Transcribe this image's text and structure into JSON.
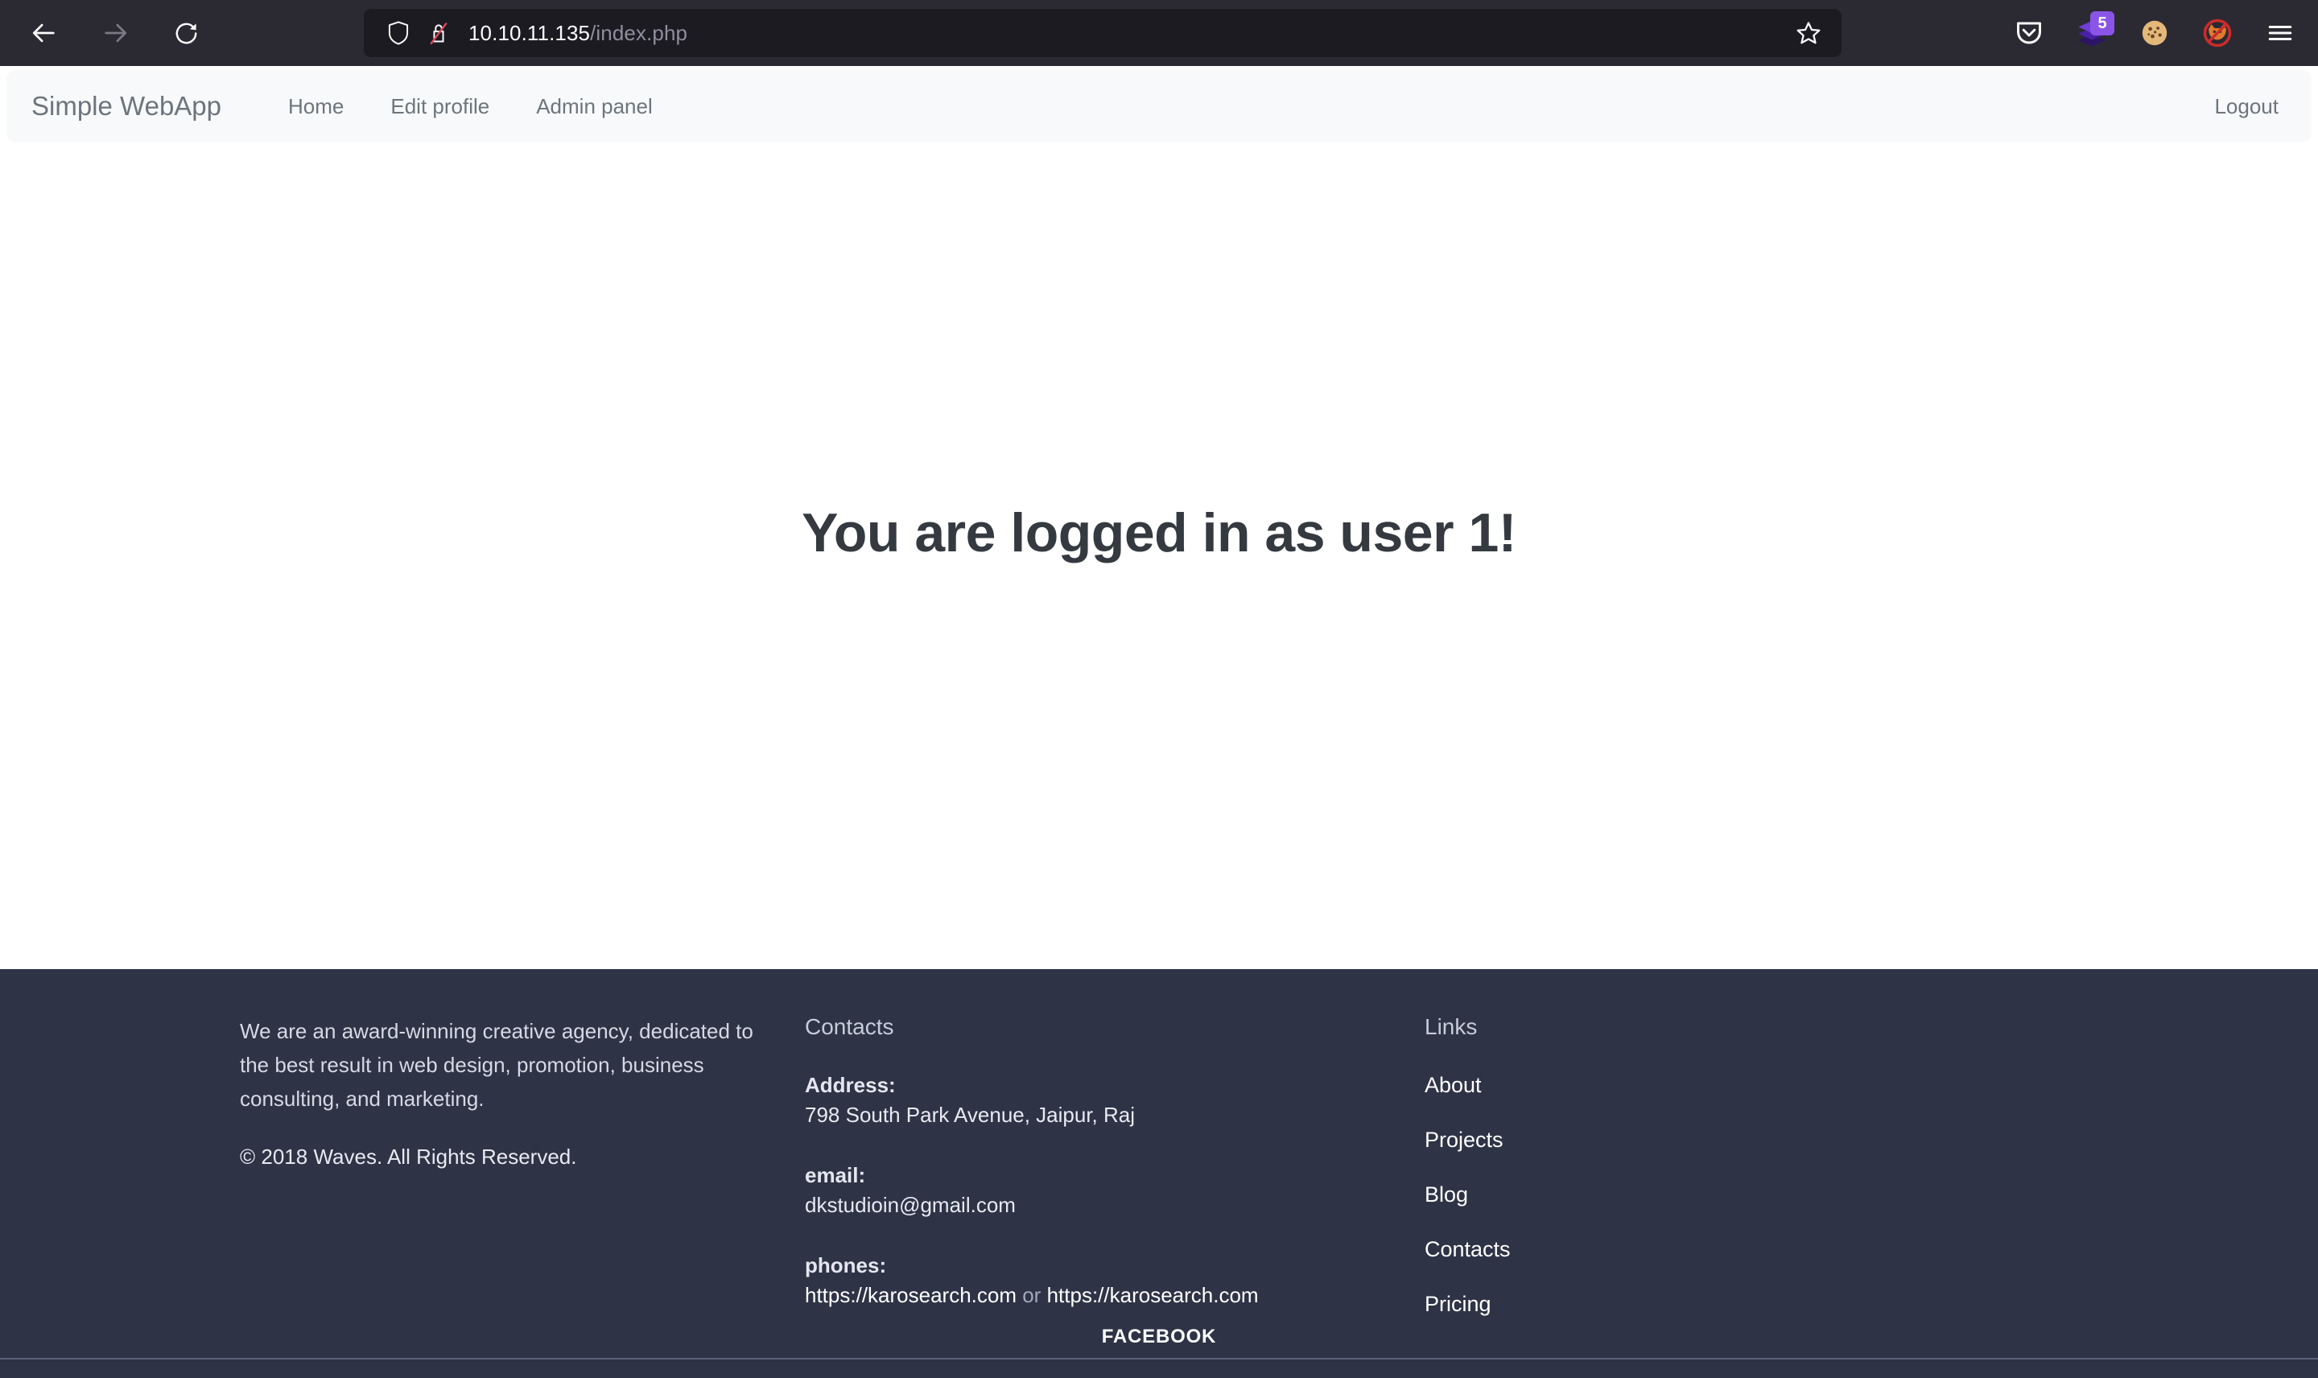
{
  "browser": {
    "back_icon": "back-arrow-icon",
    "forward_icon": "forward-arrow-icon",
    "reload_icon": "reload-icon",
    "shield_icon": "tracking-protection-shield-icon",
    "insecure_icon": "insecure-connection-lock-icon",
    "url_host": "10.10.11.135",
    "url_path": "/index.php",
    "url_full": "10.10.11.135/index.php",
    "bookmark_icon": "bookmark-star-icon",
    "extensions": [
      {
        "name": "pocket-icon",
        "glyph": "",
        "badge": ""
      },
      {
        "name": "layers-extension-icon",
        "glyph": "",
        "badge": "5"
      },
      {
        "name": "cookie-extension-icon",
        "glyph": "🍪",
        "badge": ""
      },
      {
        "name": "no-fox-extension-icon",
        "glyph": "🦊",
        "badge": ""
      }
    ],
    "menu_icon": "hamburger-menu-icon",
    "colors": {
      "chrome_bg": "#2b2a33",
      "urlbar_bg": "#1c1b22",
      "badge_purple": "#8a55e6"
    }
  },
  "navbar": {
    "brand": "Simple WebApp",
    "links": [
      {
        "label": "Home"
      },
      {
        "label": "Edit profile"
      },
      {
        "label": "Admin panel"
      }
    ],
    "logout_label": "Logout",
    "bg_color": "#f8f9fa",
    "text_color": "#6c757d"
  },
  "main": {
    "heading": "You are logged in as user 1!",
    "heading_color": "#343a40"
  },
  "footer": {
    "bg_color": "#2e3346",
    "about": {
      "description": "We are an award-winning creative agency, dedicated to the best result in web design, promotion, business consulting, and marketing.",
      "copyright": "©  2018 Waves. All Rights Reserved."
    },
    "contacts": {
      "heading": "Contacts",
      "address_label": "Address:",
      "address_value": "798 South Park Avenue, Jaipur, Raj",
      "email_label": "email:",
      "email_value": "dkstudioin@gmail.com",
      "phones_label": "phones:",
      "phone_1": "https://karosearch.com",
      "phone_separator": " or ",
      "phone_2": "https://karosearch.com"
    },
    "links": {
      "heading": "Links",
      "items": [
        {
          "label": "About"
        },
        {
          "label": "Projects"
        },
        {
          "label": "Blog"
        },
        {
          "label": "Contacts"
        },
        {
          "label": "Pricing"
        }
      ]
    },
    "social": {
      "facebook_label": "FACEBOOK"
    }
  }
}
